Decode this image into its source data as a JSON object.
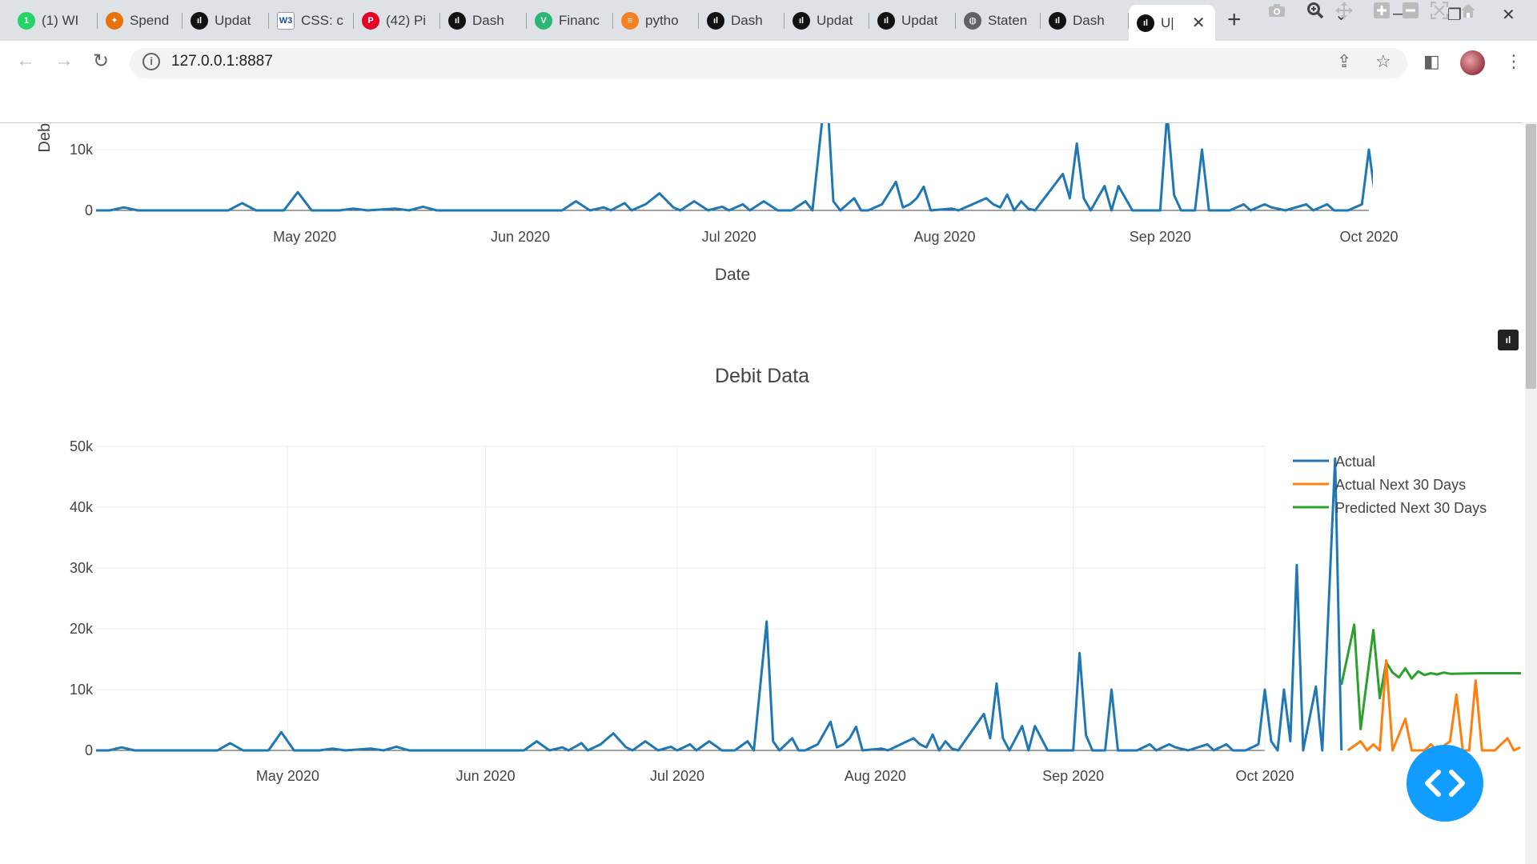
{
  "browser": {
    "tabs": [
      {
        "label": "(1) WI",
        "favicon_color": "#25d366",
        "favicon_text": "1"
      },
      {
        "label": "Spend",
        "favicon_color": "#e8710a",
        "favicon_text": "✦"
      },
      {
        "label": "Updat",
        "favicon_color": "#111111",
        "favicon_text": "ıl"
      },
      {
        "label": "CSS: c",
        "favicon_color": "#ffffff",
        "favicon_text": "W3"
      },
      {
        "label": "(42) Pi",
        "favicon_color": "#e60023",
        "favicon_text": "P"
      },
      {
        "label": "Dash",
        "favicon_color": "#111111",
        "favicon_text": "ıl"
      },
      {
        "label": "Financ",
        "favicon_color": "#2bb673",
        "favicon_text": "V"
      },
      {
        "label": "pytho",
        "favicon_color": "#f48024",
        "favicon_text": "≡"
      },
      {
        "label": "Dash",
        "favicon_color": "#111111",
        "favicon_text": "ıl"
      },
      {
        "label": "Updat",
        "favicon_color": "#111111",
        "favicon_text": "ıl"
      },
      {
        "label": "Updat",
        "favicon_color": "#111111",
        "favicon_text": "ıl"
      },
      {
        "label": "Staten",
        "favicon_color": "#5f6368",
        "favicon_text": "◍"
      },
      {
        "label": "Dash",
        "favicon_color": "#111111",
        "favicon_text": "ıl"
      },
      {
        "label": "U|",
        "favicon_color": "#111111",
        "favicon_text": "ıl",
        "active": true
      }
    ],
    "address": "127.0.0.1:8887"
  },
  "top_chart": {
    "ylabel": "Debi",
    "xlabel": "Date",
    "yticks": [
      "0",
      "10k"
    ],
    "xticks": [
      "May 2020",
      "Jun 2020",
      "Jul 2020",
      "Aug 2020",
      "Sep 2020",
      "Oct 2020"
    ]
  },
  "chart_data": {
    "type": "line",
    "title": "Debit Data",
    "xlabel": "",
    "ylabel": "",
    "x_range": [
      "2020-04-01",
      "2020-10-01"
    ],
    "ylim": [
      0,
      50000
    ],
    "yticks": [
      "0",
      "10k",
      "20k",
      "30k",
      "40k",
      "50k"
    ],
    "xticks": [
      "May 2020",
      "Jun 2020",
      "Jul 2020",
      "Aug 2020",
      "Sep 2020",
      "Oct 2020"
    ],
    "grid": true,
    "legend_position": "top-right",
    "series": [
      {
        "name": "Actual",
        "color": "#1f77b4",
        "points": [
          [
            "2020-04-01",
            0
          ],
          [
            "2020-04-03",
            0
          ],
          [
            "2020-04-05",
            500
          ],
          [
            "2020-04-07",
            0
          ],
          [
            "2020-04-10",
            0
          ],
          [
            "2020-04-15",
            0
          ],
          [
            "2020-04-20",
            0
          ],
          [
            "2020-04-22",
            1200
          ],
          [
            "2020-04-24",
            0
          ],
          [
            "2020-04-28",
            0
          ],
          [
            "2020-04-30",
            3000
          ],
          [
            "2020-05-02",
            0
          ],
          [
            "2020-05-06",
            0
          ],
          [
            "2020-05-08",
            300
          ],
          [
            "2020-05-10",
            0
          ],
          [
            "2020-05-14",
            300
          ],
          [
            "2020-05-16",
            0
          ],
          [
            "2020-05-18",
            600
          ],
          [
            "2020-05-20",
            0
          ],
          [
            "2020-05-25",
            0
          ],
          [
            "2020-06-01",
            0
          ],
          [
            "2020-06-07",
            0
          ],
          [
            "2020-06-09",
            1500
          ],
          [
            "2020-06-11",
            0
          ],
          [
            "2020-06-13",
            500
          ],
          [
            "2020-06-14",
            0
          ],
          [
            "2020-06-16",
            1200
          ],
          [
            "2020-06-17",
            0
          ],
          [
            "2020-06-19",
            1000
          ],
          [
            "2020-06-21",
            2800
          ],
          [
            "2020-06-23",
            500
          ],
          [
            "2020-06-24",
            0
          ],
          [
            "2020-06-26",
            1500
          ],
          [
            "2020-06-28",
            0
          ],
          [
            "2020-06-30",
            600
          ],
          [
            "2020-07-01",
            0
          ],
          [
            "2020-07-03",
            1000
          ],
          [
            "2020-07-04",
            0
          ],
          [
            "2020-07-06",
            1500
          ],
          [
            "2020-07-08",
            0
          ],
          [
            "2020-07-10",
            0
          ],
          [
            "2020-07-12",
            1500
          ],
          [
            "2020-07-13",
            0
          ],
          [
            "2020-07-15",
            21200
          ],
          [
            "2020-07-16",
            1500
          ],
          [
            "2020-07-17",
            0
          ],
          [
            "2020-07-19",
            2000
          ],
          [
            "2020-07-20",
            0
          ],
          [
            "2020-07-21",
            0
          ],
          [
            "2020-07-23",
            1000
          ],
          [
            "2020-07-25",
            4700
          ],
          [
            "2020-07-26",
            500
          ],
          [
            "2020-07-27",
            1000
          ],
          [
            "2020-07-28",
            2000
          ],
          [
            "2020-07-29",
            3900
          ],
          [
            "2020-07-30",
            0
          ],
          [
            "2020-08-02",
            300
          ],
          [
            "2020-08-03",
            0
          ],
          [
            "2020-08-07",
            2000
          ],
          [
            "2020-08-08",
            1000
          ],
          [
            "2020-08-09",
            500
          ],
          [
            "2020-08-10",
            2600
          ],
          [
            "2020-08-11",
            0
          ],
          [
            "2020-08-12",
            1500
          ],
          [
            "2020-08-13",
            300
          ],
          [
            "2020-08-14",
            0
          ],
          [
            "2020-08-18",
            6000
          ],
          [
            "2020-08-19",
            2000
          ],
          [
            "2020-08-20",
            11000
          ],
          [
            "2020-08-21",
            2000
          ],
          [
            "2020-08-22",
            0
          ],
          [
            "2020-08-24",
            4000
          ],
          [
            "2020-08-25",
            0
          ],
          [
            "2020-08-26",
            4000
          ],
          [
            "2020-08-28",
            0
          ],
          [
            "2020-08-31",
            0
          ],
          [
            "2020-09-01",
            0
          ],
          [
            "2020-09-02",
            16000
          ],
          [
            "2020-09-03",
            2500
          ],
          [
            "2020-09-04",
            0
          ],
          [
            "2020-09-06",
            0
          ],
          [
            "2020-09-07",
            10000
          ],
          [
            "2020-09-08",
            0
          ],
          [
            "2020-09-11",
            0
          ],
          [
            "2020-09-13",
            1000
          ],
          [
            "2020-09-14",
            0
          ],
          [
            "2020-09-16",
            1000
          ],
          [
            "2020-09-17",
            500
          ],
          [
            "2020-09-19",
            0
          ],
          [
            "2020-09-22",
            1000
          ],
          [
            "2020-09-23",
            0
          ],
          [
            "2020-09-25",
            1000
          ],
          [
            "2020-09-26",
            0
          ],
          [
            "2020-09-28",
            0
          ],
          [
            "2020-09-30",
            1000
          ],
          [
            "2020-10-01",
            10000
          ],
          [
            "2020-10-02",
            1500
          ],
          [
            "2020-10-03",
            0
          ],
          [
            "2020-10-04",
            10000
          ],
          [
            "2020-10-05",
            1500
          ],
          [
            "2020-10-06",
            30500
          ],
          [
            "2020-10-07",
            0
          ],
          [
            "2020-10-09",
            10500
          ],
          [
            "2020-10-10",
            0
          ],
          [
            "2020-10-12",
            48000
          ],
          [
            "2020-10-13",
            0
          ]
        ]
      },
      {
        "name": "Actual Next 30 Days",
        "color": "#ff7f0e",
        "points": [
          [
            "2020-10-14",
            0
          ],
          [
            "2020-10-16",
            1500
          ],
          [
            "2020-10-17",
            0
          ],
          [
            "2020-10-18",
            1000
          ],
          [
            "2020-10-19",
            0
          ],
          [
            "2020-10-20",
            14800
          ],
          [
            "2020-10-21",
            0
          ],
          [
            "2020-10-23",
            5200
          ],
          [
            "2020-10-24",
            0
          ],
          [
            "2020-10-26",
            0
          ],
          [
            "2020-10-27",
            1000
          ],
          [
            "2020-10-28",
            0
          ],
          [
            "2020-10-30",
            1500
          ],
          [
            "2020-10-31",
            9200
          ],
          [
            "2020-11-01",
            0
          ],
          [
            "2020-11-02",
            0
          ],
          [
            "2020-11-03",
            11500
          ],
          [
            "2020-11-04",
            0
          ],
          [
            "2020-11-06",
            0
          ],
          [
            "2020-11-08",
            2000
          ],
          [
            "2020-11-09",
            0
          ],
          [
            "2020-11-10",
            500
          ]
        ]
      },
      {
        "name": "Predicted Next 30 Days",
        "color": "#2ca02c",
        "points": [
          [
            "2020-10-13",
            10800
          ],
          [
            "2020-10-15",
            20700
          ],
          [
            "2020-10-16",
            3500
          ],
          [
            "2020-10-18",
            19800
          ],
          [
            "2020-10-19",
            8600
          ],
          [
            "2020-10-20",
            14500
          ],
          [
            "2020-10-21",
            12800
          ],
          [
            "2020-10-22",
            12000
          ],
          [
            "2020-10-23",
            13500
          ],
          [
            "2020-10-24",
            11800
          ],
          [
            "2020-10-25",
            13000
          ],
          [
            "2020-10-26",
            12400
          ],
          [
            "2020-10-27",
            12700
          ],
          [
            "2020-10-28",
            12500
          ],
          [
            "2020-10-29",
            12800
          ],
          [
            "2020-10-30",
            12600
          ],
          [
            "2020-11-04",
            12700
          ],
          [
            "2020-11-16",
            12700
          ]
        ]
      }
    ]
  },
  "colors": {
    "plotly_blue": "#1f77b4",
    "plotly_orange": "#ff7f0e",
    "plotly_green": "#2ca02c",
    "fab_blue": "#119dff"
  },
  "modebar": [
    "camera-icon",
    "zoom-icon",
    "pan-icon",
    "zoom-in-icon",
    "zoom-out-icon",
    "autoscale-icon",
    "reset-axes-icon",
    "plotly-logo-icon"
  ]
}
